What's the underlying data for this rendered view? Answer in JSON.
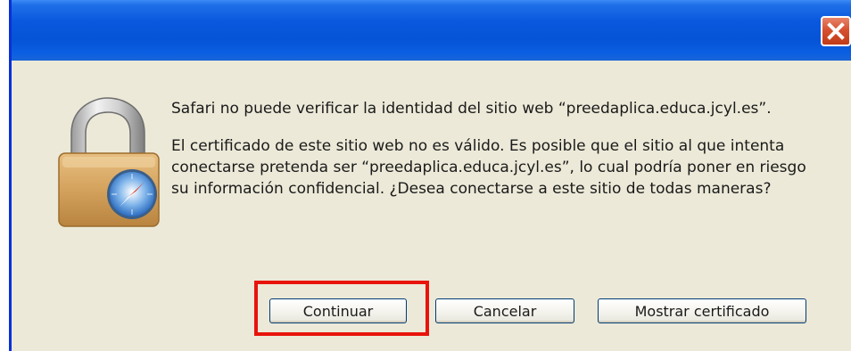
{
  "dialog": {
    "title": "",
    "message_line1": "Safari no puede verificar la identidad del sitio web “preedaplica.educa.jcyl.es”.",
    "message_line2": "El certificado de este sitio web no es válido. Es posible que el sitio al que intenta conectarse pretenda ser “preedaplica.educa.jcyl.es”, lo cual podría poner en riesgo su información confidencial. ¿Desea conectarse a este sitio de todas maneras?",
    "buttons": {
      "continue_label": "Continuar",
      "cancel_label": "Cancelar",
      "show_cert_label": "Mostrar certificado"
    }
  },
  "icons": {
    "close": "close-icon",
    "lock": "lock-icon"
  },
  "colors": {
    "titlebar": "#0553d6",
    "dialog_bg": "#ece9d8",
    "close_button": "#c13b17",
    "highlight": "#e8140c"
  }
}
